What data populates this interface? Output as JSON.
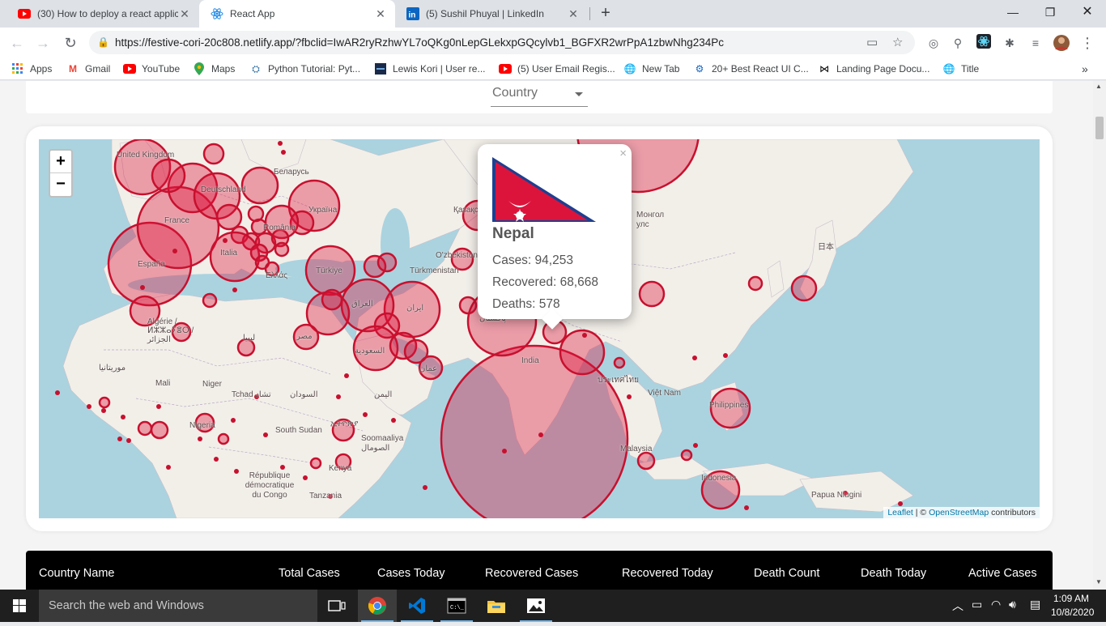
{
  "browser": {
    "tabs": [
      {
        "title": "(30) How to deploy a react applic",
        "favicon": "youtube-icon"
      },
      {
        "title": "React App",
        "favicon": "react-icon",
        "active": true
      },
      {
        "title": "(5) Sushil Phuyal | LinkedIn",
        "favicon": "linkedin-icon"
      }
    ],
    "url": "https://festive-cori-20c808.netlify.app/?fbclid=IwAR2ryRzhwYL7oQKg0nLepGLekxpGQcylvb1_BGFXR2wrPpA1zbwNhg234Pc",
    "bookmarks": [
      {
        "label": "Apps",
        "icon": "apps-grid-icon"
      },
      {
        "label": "Gmail",
        "icon": "gmail-icon"
      },
      {
        "label": "YouTube",
        "icon": "youtube-icon"
      },
      {
        "label": "Maps",
        "icon": "maps-pin-icon"
      },
      {
        "label": "Python Tutorial: Pyt...",
        "icon": "python-icon"
      },
      {
        "label": "Lewis Kori | User re...",
        "icon": "site-icon"
      },
      {
        "label": "(5) User Email Regis...",
        "icon": "youtube-icon"
      },
      {
        "label": "New Tab",
        "icon": "globe-icon"
      },
      {
        "label": "20+ Best React UI C...",
        "icon": "gear-icon"
      },
      {
        "label": "Landing Page Docu...",
        "icon": "bow-icon"
      },
      {
        "label": "Title",
        "icon": "globe-icon"
      }
    ]
  },
  "page": {
    "country_select": "Country",
    "map": {
      "zoom_in": "+",
      "zoom_out": "−",
      "attribution": {
        "leaflet": "Leaflet",
        "sep": " | © ",
        "osm": "OpenStreetMap",
        "suffix": " contributors"
      },
      "labels": [
        {
          "text": "United Kingdom"
        },
        {
          "text": "Беларусь"
        },
        {
          "text": "Deutschland"
        },
        {
          "text": "Україна"
        },
        {
          "text": "France"
        },
        {
          "text": "România"
        },
        {
          "text": "España"
        },
        {
          "text": "Italia"
        },
        {
          "text": "Türkiye"
        },
        {
          "text": "Ελλάς"
        },
        {
          "text": "Algérie / ⵍⵣⵣⴰⵢⴻⵔ / الجزائر"
        },
        {
          "text": "ليبيا"
        },
        {
          "text": "مصر"
        },
        {
          "text": "العراق"
        },
        {
          "text": "ایران"
        },
        {
          "text": "السعودية"
        },
        {
          "text": "Türkmenistan"
        },
        {
          "text": "O'zbekiston"
        },
        {
          "text": "Қазақстан"
        },
        {
          "text": "Монгол улс"
        },
        {
          "text": "日本"
        },
        {
          "text": "پاکستان"
        },
        {
          "text": "India"
        },
        {
          "text": "عمان"
        },
        {
          "text": "موريتانيا"
        },
        {
          "text": "Mali"
        },
        {
          "text": "Niger"
        },
        {
          "text": "Tchad تشاد"
        },
        {
          "text": "السودان"
        },
        {
          "text": "اليمن"
        },
        {
          "text": "Nigeria"
        },
        {
          "text": "ኢትዮጵያ"
        },
        {
          "text": "South Sudan"
        },
        {
          "text": "Soomaaliya الصومال"
        },
        {
          "text": "Kenya"
        },
        {
          "text": "République démocratique du Congo"
        },
        {
          "text": "Tanzania"
        },
        {
          "text": "Việt Nam"
        },
        {
          "text": "Philippines"
        },
        {
          "text": "Malaysia"
        },
        {
          "text": "Indonesia"
        },
        {
          "text": "Papua Niugini"
        },
        {
          "text": "ประเทศไทย"
        }
      ]
    },
    "popup": {
      "country": "Nepal",
      "cases": "Cases: 94,253",
      "recovered": "Recovered: 68,668",
      "deaths": "Deaths: 578"
    },
    "table_headers": [
      "Country Name",
      "Total Cases",
      "Cases Today",
      "Recovered Cases",
      "Recovered Today",
      "Death Count",
      "Death Today",
      "Active Cases"
    ]
  },
  "taskbar": {
    "search_placeholder": "Search the web and Windows",
    "time": "1:09 AM",
    "date": "10/8/2020"
  },
  "colors": {
    "circle_fill": "#dc143c",
    "circle_stroke": "#c8102e",
    "water": "#aad3df",
    "land": "#f2efe9"
  }
}
